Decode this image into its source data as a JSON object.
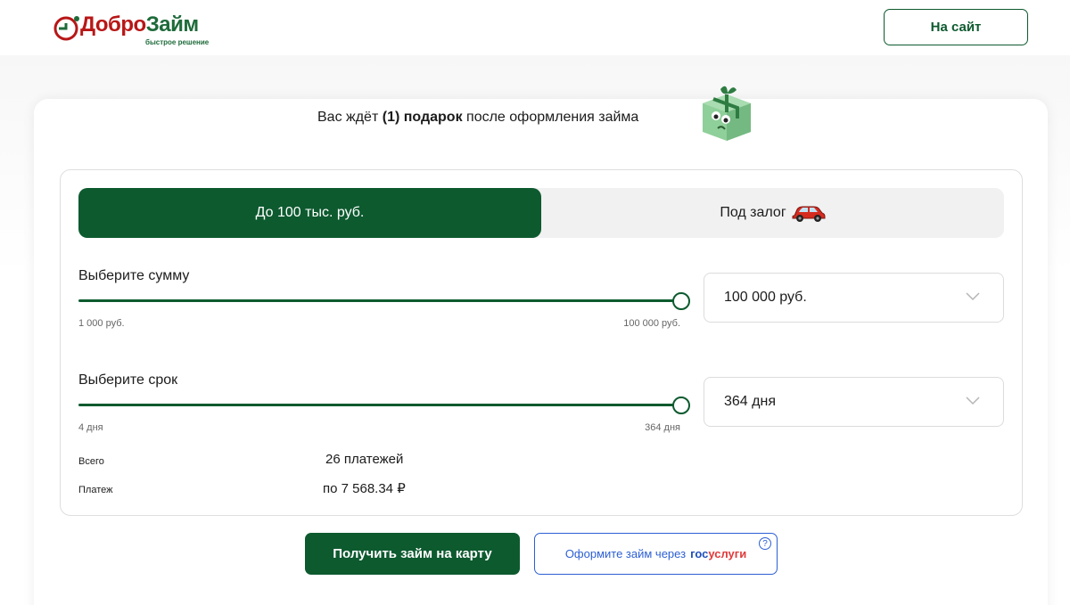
{
  "header": {
    "logo_part1": "Добро",
    "logo_part2": "Займ",
    "logo_tagline": "быстрое решение",
    "site_button": "На сайт"
  },
  "promo": {
    "prefix": "Вас ждёт ",
    "bold": "(1) подарок",
    "suffix": " после оформления займа",
    "gift_icon": "gift-box-mascot-icon"
  },
  "tabs": [
    {
      "label": "До 100 тыс. руб.",
      "active": true
    },
    {
      "label": "Под залог",
      "icon": "car-icon",
      "active": false
    }
  ],
  "amount": {
    "label": "Выберите сумму",
    "min_label": "1 000 руб.",
    "max_label": "100 000 руб.",
    "value_fraction": 1.0,
    "selected": "100 000 руб."
  },
  "term": {
    "label": "Выберите срок",
    "min_label": "4 дня",
    "max_label": "364 дня",
    "value_fraction": 1.0,
    "selected": "364 дня"
  },
  "summary": {
    "total_label": "Всего",
    "total_value": "26 платежей",
    "payment_label": "Платеж",
    "payment_value": "по 7 568.34 ₽"
  },
  "actions": {
    "get_loan": "Получить займ на карту",
    "gosuslugi_prefix": "Оформите займ через",
    "gosuslugi_brand_a": "гос",
    "gosuslugi_brand_b": "услуги",
    "help": "?"
  },
  "colors": {
    "brand_green": "#0d5a2f",
    "brand_red": "#b81717",
    "gos_blue": "#2c5fd4"
  }
}
